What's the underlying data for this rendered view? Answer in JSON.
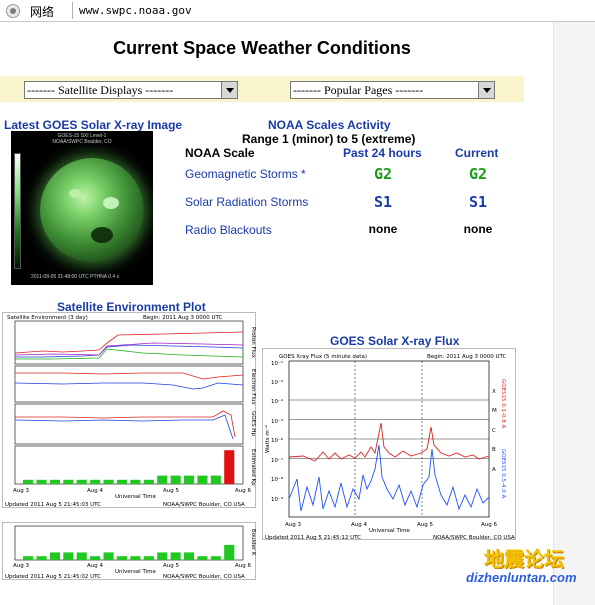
{
  "browser": {
    "address_label": "网络",
    "url": "www.swpc.noaa.gov"
  },
  "page": {
    "title": "Current Space Weather Conditions"
  },
  "dropdowns": {
    "satellite": "------- Satellite Displays -------",
    "popular": "------- Popular Pages -------"
  },
  "xray_image": {
    "title": "Latest GOES Solar X-ray Image",
    "caption_1": "GOES-15 SXI  Level-1",
    "caption_2": "NOAA/SWPC Boulder, CO",
    "timestamp": "2011-08-05 21:48:00 UTC     PTHNA      0.4 s"
  },
  "scales": {
    "title": "NOAA Scales Activity",
    "range": "Range 1 (minor) to 5 (extreme)",
    "header": {
      "scale": "NOAA Scale",
      "past": "Past 24 hours",
      "current": "Current"
    },
    "rows": [
      {
        "label": "Geomagnetic Storms *",
        "past": "G2",
        "current": "G2",
        "style": "green"
      },
      {
        "label": "Solar Radiation Storms",
        "past": "S1",
        "current": "S1",
        "style": "blue"
      },
      {
        "label": "Radio Blackouts",
        "past": "none",
        "current": "none",
        "style": "plain"
      }
    ]
  },
  "env_plot": {
    "title": "Satellite Environment Plot",
    "header_left": "Satellite Environment (3 day)",
    "header_right": "Begin: 2011 Aug 3 0000 UTC",
    "panel_labels": [
      "Proton Flux",
      "Electron Flux",
      "GOES Hp",
      "Estimated Kp",
      "Boulder K"
    ],
    "x_ticks": [
      "Aug 3",
      "Aug 4",
      "Aug 5",
      "Aug 6"
    ],
    "x_title": "Universal Time",
    "updated": "Updated 2011 Aug  5 21:45:03 UTC",
    "updated_2": "Updated 2011 Aug  5 21:45:02 UTC",
    "credit": "NOAA/SWPC Boulder, CO USA",
    "kp_values": [
      1,
      1,
      1,
      1,
      1,
      1,
      1,
      1,
      1,
      1,
      2,
      2,
      2,
      2,
      2,
      8
    ],
    "bk_values": [
      1,
      1,
      2,
      2,
      2,
      1,
      2,
      1,
      1,
      1,
      2,
      2,
      2,
      1,
      1,
      4
    ]
  },
  "xray_plot": {
    "title": "GOES Solar X-ray Flux",
    "header_left": "GOES Xray Flux (5 minute data)",
    "header_right": "Begin: 2011 Aug 3 0000 UTC",
    "y_label": "Watts m⁻²",
    "y_ticks": [
      "10⁻²",
      "10⁻³",
      "10⁻⁴",
      "10⁻⁵",
      "10⁻⁶",
      "10⁻⁷",
      "10⁻⁸",
      "10⁻⁹"
    ],
    "right_labels": [
      "X",
      "M",
      "C",
      "B",
      "A"
    ],
    "series_labels": [
      "GOES15 0.1-0.8 A",
      "GOES15 0.5-4.0 A"
    ],
    "x_ticks": [
      "Aug 3",
      "Aug 4",
      "Aug 5",
      "Aug 6"
    ],
    "x_title": "Universal Time",
    "updated": "Updated 2011 Aug  5 21:45:12 UTC",
    "credit": "NOAA/SWPC Boulder, CO USA"
  },
  "watermark": {
    "cn": "地震论坛",
    "site": "dizhenluntan.com"
  },
  "colors": {
    "link": "#1a3aa8",
    "green": "#1a9a1a",
    "banner": "#faf5cc",
    "kp_green": "#22c722",
    "kp_red": "#e01010"
  }
}
